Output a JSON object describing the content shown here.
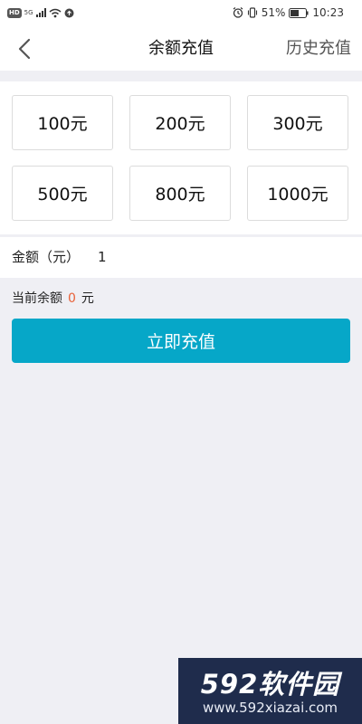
{
  "status_bar": {
    "network": "HD",
    "signal": "5G",
    "battery_percent": "51%",
    "time": "10:23"
  },
  "nav": {
    "title": "余额充值",
    "history": "历史充值"
  },
  "amount_options": [
    "100元",
    "200元",
    "300元",
    "500元",
    "800元",
    "1000元"
  ],
  "amount_input": {
    "label": "金额（元）",
    "value": "1"
  },
  "balance": {
    "label": "当前余额",
    "value": "0",
    "unit": "元"
  },
  "recharge_button": "立即充值",
  "watermark": {
    "main": "592软件园",
    "url": "www.592xiazai.com"
  },
  "colors": {
    "accent": "#06a7c8",
    "balance_value": "#e8623a",
    "background": "#efeff4"
  }
}
